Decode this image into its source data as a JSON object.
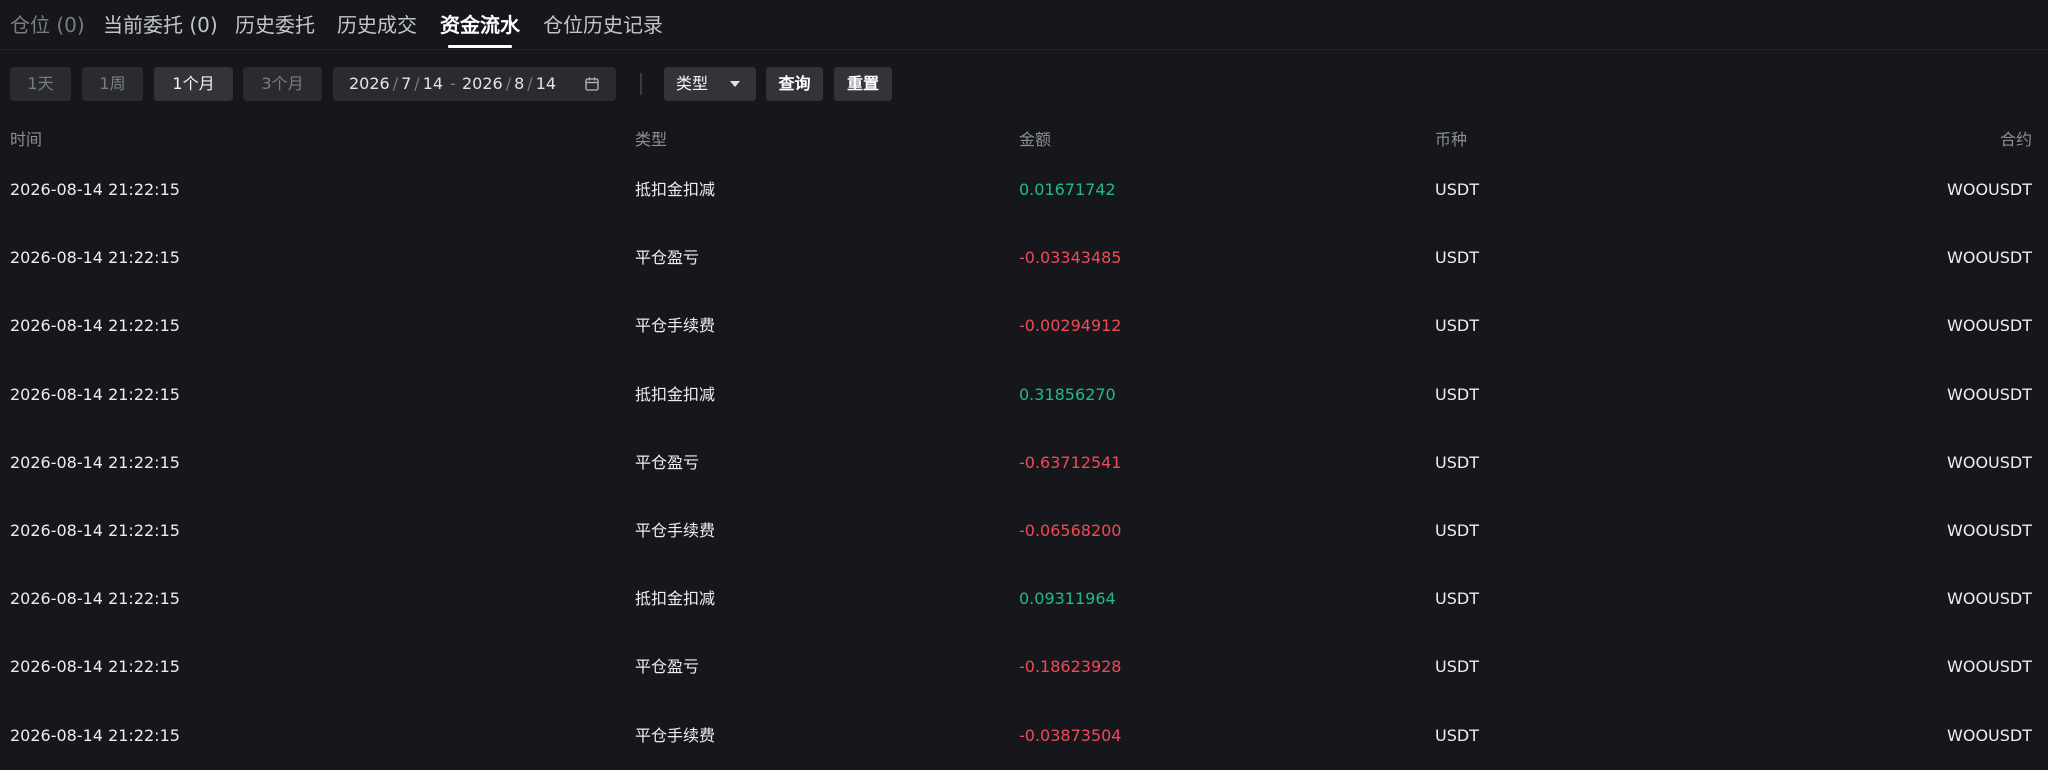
{
  "tabs": [
    {
      "label": "仓位 (0)",
      "state": "dim"
    },
    {
      "label": "当前委托 (0)",
      "state": "normal"
    },
    {
      "label": "历史委托",
      "state": "normal"
    },
    {
      "label": "历史成交",
      "state": "normal"
    },
    {
      "label": "资金流水",
      "state": "active"
    },
    {
      "label": "仓位历史记录",
      "state": "normal"
    }
  ],
  "filters": {
    "periods": [
      "1天",
      "1周",
      "1个月",
      "3个月"
    ],
    "selected_period": "1个月",
    "date_start": {
      "year": "2026",
      "month": "7",
      "day": "14"
    },
    "date_end": {
      "year": "2026",
      "month": "8",
      "day": "14"
    },
    "date_sep": "/",
    "range_sep": "-",
    "type_label": "类型",
    "query_label": "查询",
    "reset_label": "重置"
  },
  "table": {
    "headers": [
      "时间",
      "类型",
      "金额",
      "币种",
      "合约"
    ],
    "rows": [
      {
        "time": "2026-08-14 21:22:15",
        "type": "抵扣金扣减",
        "amount": "0.01671742",
        "sign": "pos",
        "currency": "USDT",
        "contract": "WOOUSDT"
      },
      {
        "time": "2026-08-14 21:22:15",
        "type": "平仓盈亏",
        "amount": "-0.03343485",
        "sign": "neg",
        "currency": "USDT",
        "contract": "WOOUSDT"
      },
      {
        "time": "2026-08-14 21:22:15",
        "type": "平仓手续费",
        "amount": "-0.00294912",
        "sign": "neg",
        "currency": "USDT",
        "contract": "WOOUSDT"
      },
      {
        "time": "2026-08-14 21:22:15",
        "type": "抵扣金扣减",
        "amount": "0.31856270",
        "sign": "pos",
        "currency": "USDT",
        "contract": "WOOUSDT"
      },
      {
        "time": "2026-08-14 21:22:15",
        "type": "平仓盈亏",
        "amount": "-0.63712541",
        "sign": "neg",
        "currency": "USDT",
        "contract": "WOOUSDT"
      },
      {
        "time": "2026-08-14 21:22:15",
        "type": "平仓手续费",
        "amount": "-0.06568200",
        "sign": "neg",
        "currency": "USDT",
        "contract": "WOOUSDT"
      },
      {
        "time": "2026-08-14 21:22:15",
        "type": "抵扣金扣减",
        "amount": "0.09311964",
        "sign": "pos",
        "currency": "USDT",
        "contract": "WOOUSDT"
      },
      {
        "time": "2026-08-14 21:22:15",
        "type": "平仓盈亏",
        "amount": "-0.18623928",
        "sign": "neg",
        "currency": "USDT",
        "contract": "WOOUSDT"
      },
      {
        "time": "2026-08-14 21:22:15",
        "type": "平仓手续费",
        "amount": "-0.03873504",
        "sign": "neg",
        "currency": "USDT",
        "contract": "WOOUSDT"
      }
    ]
  },
  "colors": {
    "background": "#16171c",
    "positive": "#21bb8a",
    "negative": "#f04a55",
    "active_tab": "#ffffff"
  },
  "icons": {
    "calendar": "calendar-icon",
    "dropdown": "caret-down-icon"
  }
}
